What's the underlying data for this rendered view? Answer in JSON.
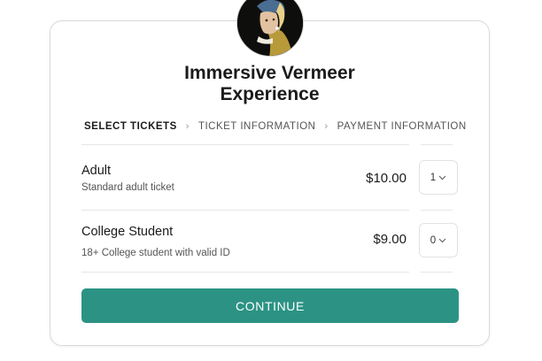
{
  "event": {
    "title_line1": "Immersive Vermeer",
    "title_line2": "Experience",
    "avatar_icon": "girl-with-pearl-earring-portrait"
  },
  "steps": [
    {
      "label": "SELECT TICKETS",
      "active": true
    },
    {
      "label": "TICKET INFORMATION",
      "active": false
    },
    {
      "label": "PAYMENT INFORMATION",
      "active": false
    }
  ],
  "tickets": [
    {
      "name": "Adult",
      "description": "Standard adult ticket",
      "price": "$10.00",
      "quantity": "1"
    },
    {
      "name": "College Student",
      "description": "18+ College student with valid ID",
      "price": "$9.00",
      "quantity": "0"
    }
  ],
  "actions": {
    "continue_label": "CONTINUE"
  },
  "colors": {
    "accent": "#2c9384",
    "border": "#d9d9d9"
  }
}
